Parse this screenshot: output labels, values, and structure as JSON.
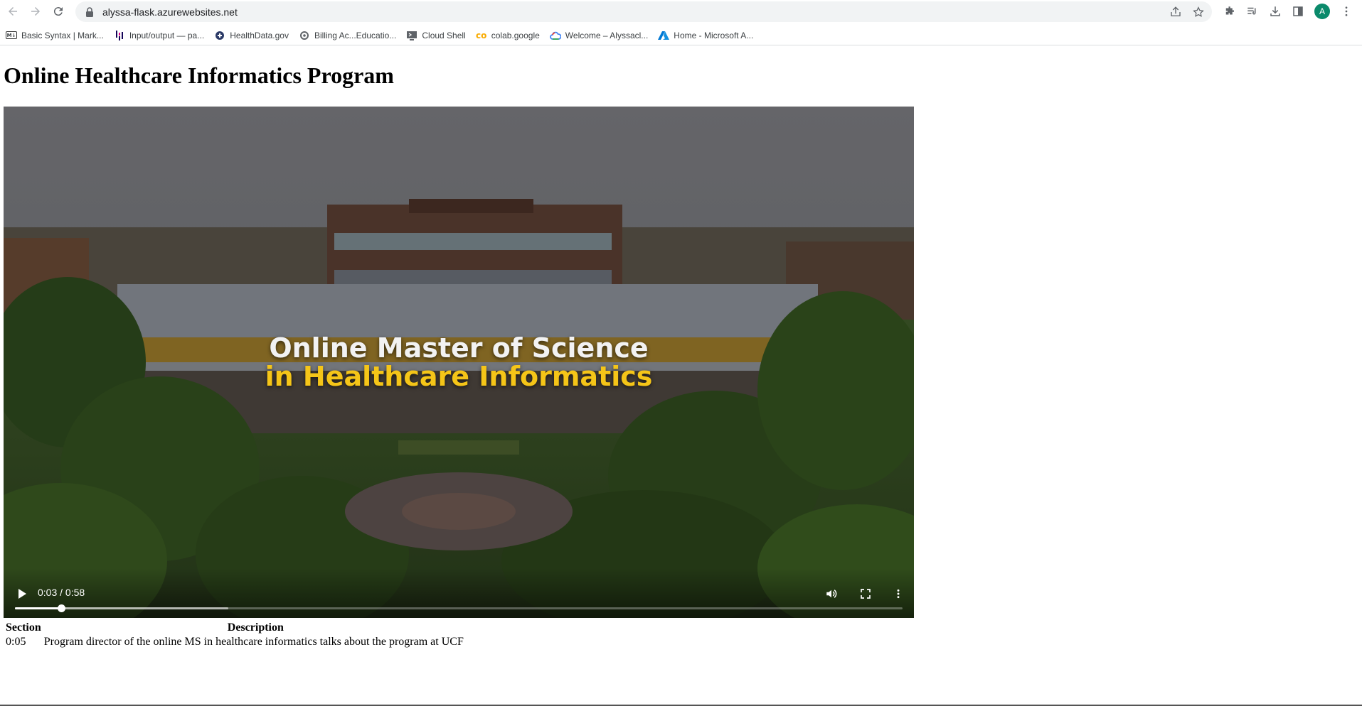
{
  "browser": {
    "url": "alyssa-flask.azurewebsites.net",
    "profile_initial": "A",
    "bookmarks": [
      {
        "label": "Basic Syntax | Mark...",
        "icon": "markdown-icon"
      },
      {
        "label": "Input/output — pa...",
        "icon": "pandas-icon"
      },
      {
        "label": "HealthData.gov",
        "icon": "healthdata-icon"
      },
      {
        "label": "Billing Ac...Educatio...",
        "icon": "settings-icon"
      },
      {
        "label": "Cloud Shell",
        "icon": "cloud-shell-icon"
      },
      {
        "label": "colab.google",
        "icon": "colab-icon"
      },
      {
        "label": "Welcome – Alyssacl...",
        "icon": "google-cloud-icon"
      },
      {
        "label": "Home - Microsoft A...",
        "icon": "azure-icon"
      }
    ]
  },
  "page": {
    "title": "Online Healthcare Informatics Program"
  },
  "video": {
    "overlay_line1": "Online Master of Science",
    "overlay_line2": "in Healthcare Informatics",
    "time": "0:03 / 0:58",
    "played_fraction": 0.0517,
    "buffered_fraction": 0.24
  },
  "table": {
    "headers": [
      "Section",
      "Description"
    ],
    "rows": [
      {
        "section": "0:05",
        "description": "Program director of the online MS in healthcare informatics talks about the program at UCF"
      }
    ]
  },
  "colors": {
    "accent_yellow": "#f5c518",
    "profile_green": "#0b8a6b"
  }
}
